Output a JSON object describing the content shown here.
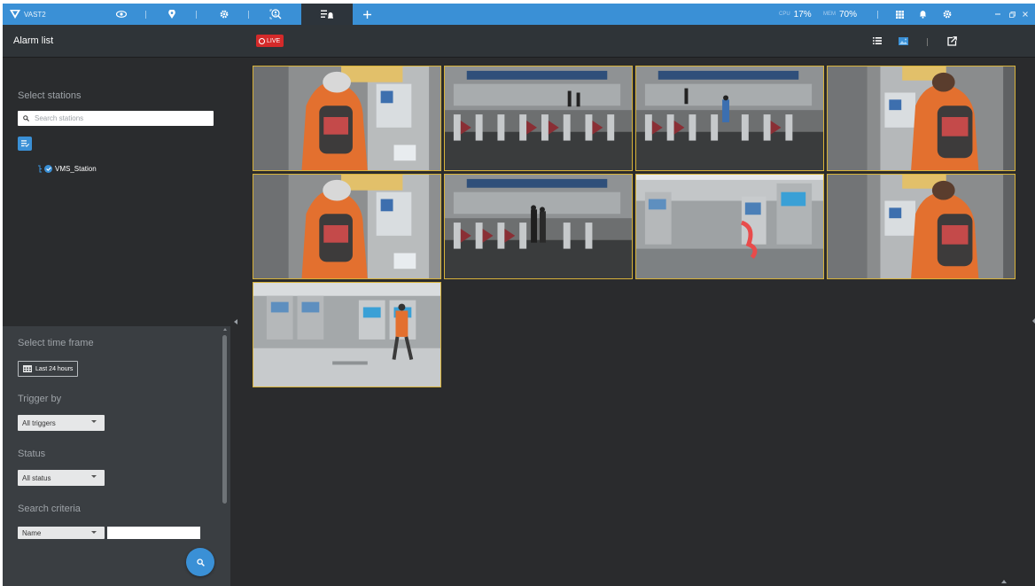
{
  "app": {
    "name": "VAST2"
  },
  "topbar": {
    "icons": [
      "eye-icon",
      "pin-icon",
      "gear-icon",
      "search-person-icon",
      "alarm-list-icon",
      "plus-icon"
    ],
    "cpu_label": "CPU",
    "cpu_value": "17%",
    "mem_label": "MEM",
    "mem_value": "70%",
    "right_icons": [
      "grid-icon",
      "bell-icon",
      "gear-icon",
      "minimize-icon",
      "restore-icon",
      "close-icon"
    ]
  },
  "page": {
    "title": "Alarm list",
    "live_label": "LIVE"
  },
  "sidebar": {
    "select_stations_label": "Select stations",
    "search_placeholder": "Search stations",
    "station_name": "VMS_Station",
    "select_time_frame_label": "Select time frame",
    "time_frame_value": "Last 24 hours",
    "trigger_by_label": "Trigger by",
    "trigger_value": "All triggers",
    "status_label": "Status",
    "status_value": "All status",
    "search_criteria_label": "Search criteria",
    "criteria_field": "Name",
    "criteria_value": ""
  },
  "thumbnails": [
    {
      "scene": "person-backpack-close"
    },
    {
      "scene": "station-gates"
    },
    {
      "scene": "station-gates-people"
    },
    {
      "scene": "person-backpack-right"
    },
    {
      "scene": "person-backpack-close"
    },
    {
      "scene": "station-gates-two"
    },
    {
      "scene": "ticket-machines"
    },
    {
      "scene": "person-backpack-right"
    },
    {
      "scene": "ticket-machines-walker"
    }
  ],
  "colors": {
    "accent": "#3a90d6",
    "live": "#d42a2a",
    "thumb_border": "#d7b23a"
  }
}
